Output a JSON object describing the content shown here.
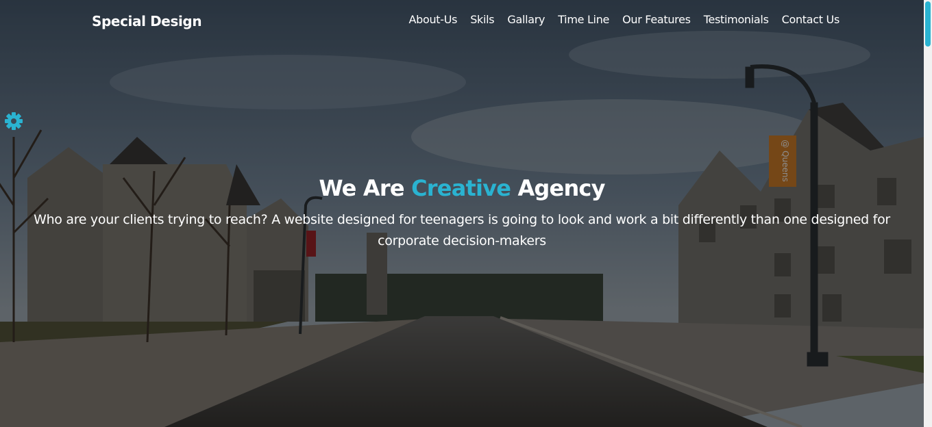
{
  "header": {
    "logo": "Special Design",
    "nav": [
      "About-Us",
      "Skils",
      "Gallary",
      "Time Line",
      "Our Features",
      "Testimonials",
      "Contact Us"
    ]
  },
  "hero": {
    "title_before": "We Are ",
    "title_accent": "Creative",
    "title_after": " Agency",
    "subtitle": "Who are your clients trying to reach? A website designed for teenagers is going to look and work a bit differently than one designed for corporate decision-makers",
    "banner_text": "@ Queens"
  },
  "icons": {
    "settings": "gear-icon"
  },
  "colors": {
    "accent": "#2ab3d1",
    "overlay": "rgba(0,0,0,0.45)"
  }
}
